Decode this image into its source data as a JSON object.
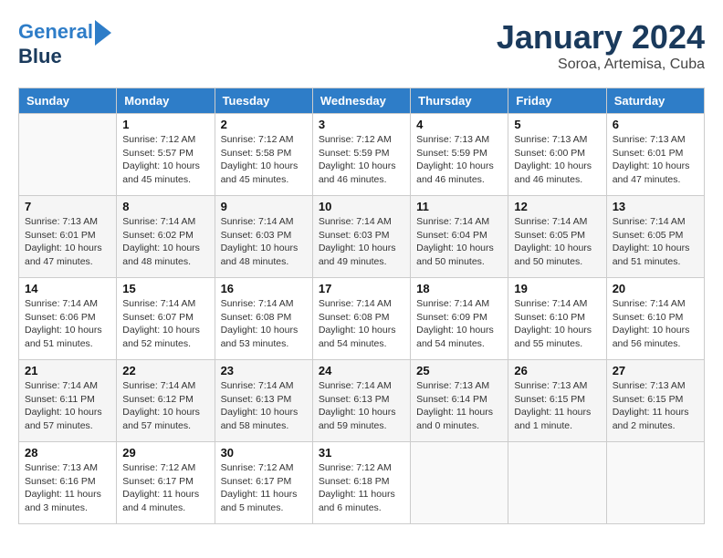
{
  "header": {
    "logo_line1": "General",
    "logo_line2": "Blue",
    "month": "January 2024",
    "location": "Soroa, Artemisa, Cuba"
  },
  "weekdays": [
    "Sunday",
    "Monday",
    "Tuesday",
    "Wednesday",
    "Thursday",
    "Friday",
    "Saturday"
  ],
  "weeks": [
    [
      {
        "day": "",
        "info": ""
      },
      {
        "day": "1",
        "info": "Sunrise: 7:12 AM\nSunset: 5:57 PM\nDaylight: 10 hours\nand 45 minutes."
      },
      {
        "day": "2",
        "info": "Sunrise: 7:12 AM\nSunset: 5:58 PM\nDaylight: 10 hours\nand 45 minutes."
      },
      {
        "day": "3",
        "info": "Sunrise: 7:12 AM\nSunset: 5:59 PM\nDaylight: 10 hours\nand 46 minutes."
      },
      {
        "day": "4",
        "info": "Sunrise: 7:13 AM\nSunset: 5:59 PM\nDaylight: 10 hours\nand 46 minutes."
      },
      {
        "day": "5",
        "info": "Sunrise: 7:13 AM\nSunset: 6:00 PM\nDaylight: 10 hours\nand 46 minutes."
      },
      {
        "day": "6",
        "info": "Sunrise: 7:13 AM\nSunset: 6:01 PM\nDaylight: 10 hours\nand 47 minutes."
      }
    ],
    [
      {
        "day": "7",
        "info": "Sunrise: 7:13 AM\nSunset: 6:01 PM\nDaylight: 10 hours\nand 47 minutes."
      },
      {
        "day": "8",
        "info": "Sunrise: 7:14 AM\nSunset: 6:02 PM\nDaylight: 10 hours\nand 48 minutes."
      },
      {
        "day": "9",
        "info": "Sunrise: 7:14 AM\nSunset: 6:03 PM\nDaylight: 10 hours\nand 48 minutes."
      },
      {
        "day": "10",
        "info": "Sunrise: 7:14 AM\nSunset: 6:03 PM\nDaylight: 10 hours\nand 49 minutes."
      },
      {
        "day": "11",
        "info": "Sunrise: 7:14 AM\nSunset: 6:04 PM\nDaylight: 10 hours\nand 50 minutes."
      },
      {
        "day": "12",
        "info": "Sunrise: 7:14 AM\nSunset: 6:05 PM\nDaylight: 10 hours\nand 50 minutes."
      },
      {
        "day": "13",
        "info": "Sunrise: 7:14 AM\nSunset: 6:05 PM\nDaylight: 10 hours\nand 51 minutes."
      }
    ],
    [
      {
        "day": "14",
        "info": "Sunrise: 7:14 AM\nSunset: 6:06 PM\nDaylight: 10 hours\nand 51 minutes."
      },
      {
        "day": "15",
        "info": "Sunrise: 7:14 AM\nSunset: 6:07 PM\nDaylight: 10 hours\nand 52 minutes."
      },
      {
        "day": "16",
        "info": "Sunrise: 7:14 AM\nSunset: 6:08 PM\nDaylight: 10 hours\nand 53 minutes."
      },
      {
        "day": "17",
        "info": "Sunrise: 7:14 AM\nSunset: 6:08 PM\nDaylight: 10 hours\nand 54 minutes."
      },
      {
        "day": "18",
        "info": "Sunrise: 7:14 AM\nSunset: 6:09 PM\nDaylight: 10 hours\nand 54 minutes."
      },
      {
        "day": "19",
        "info": "Sunrise: 7:14 AM\nSunset: 6:10 PM\nDaylight: 10 hours\nand 55 minutes."
      },
      {
        "day": "20",
        "info": "Sunrise: 7:14 AM\nSunset: 6:10 PM\nDaylight: 10 hours\nand 56 minutes."
      }
    ],
    [
      {
        "day": "21",
        "info": "Sunrise: 7:14 AM\nSunset: 6:11 PM\nDaylight: 10 hours\nand 57 minutes."
      },
      {
        "day": "22",
        "info": "Sunrise: 7:14 AM\nSunset: 6:12 PM\nDaylight: 10 hours\nand 57 minutes."
      },
      {
        "day": "23",
        "info": "Sunrise: 7:14 AM\nSunset: 6:13 PM\nDaylight: 10 hours\nand 58 minutes."
      },
      {
        "day": "24",
        "info": "Sunrise: 7:14 AM\nSunset: 6:13 PM\nDaylight: 10 hours\nand 59 minutes."
      },
      {
        "day": "25",
        "info": "Sunrise: 7:13 AM\nSunset: 6:14 PM\nDaylight: 11 hours\nand 0 minutes."
      },
      {
        "day": "26",
        "info": "Sunrise: 7:13 AM\nSunset: 6:15 PM\nDaylight: 11 hours\nand 1 minute."
      },
      {
        "day": "27",
        "info": "Sunrise: 7:13 AM\nSunset: 6:15 PM\nDaylight: 11 hours\nand 2 minutes."
      }
    ],
    [
      {
        "day": "28",
        "info": "Sunrise: 7:13 AM\nSunset: 6:16 PM\nDaylight: 11 hours\nand 3 minutes."
      },
      {
        "day": "29",
        "info": "Sunrise: 7:12 AM\nSunset: 6:17 PM\nDaylight: 11 hours\nand 4 minutes."
      },
      {
        "day": "30",
        "info": "Sunrise: 7:12 AM\nSunset: 6:17 PM\nDaylight: 11 hours\nand 5 minutes."
      },
      {
        "day": "31",
        "info": "Sunrise: 7:12 AM\nSunset: 6:18 PM\nDaylight: 11 hours\nand 6 minutes."
      },
      {
        "day": "",
        "info": ""
      },
      {
        "day": "",
        "info": ""
      },
      {
        "day": "",
        "info": ""
      }
    ]
  ]
}
